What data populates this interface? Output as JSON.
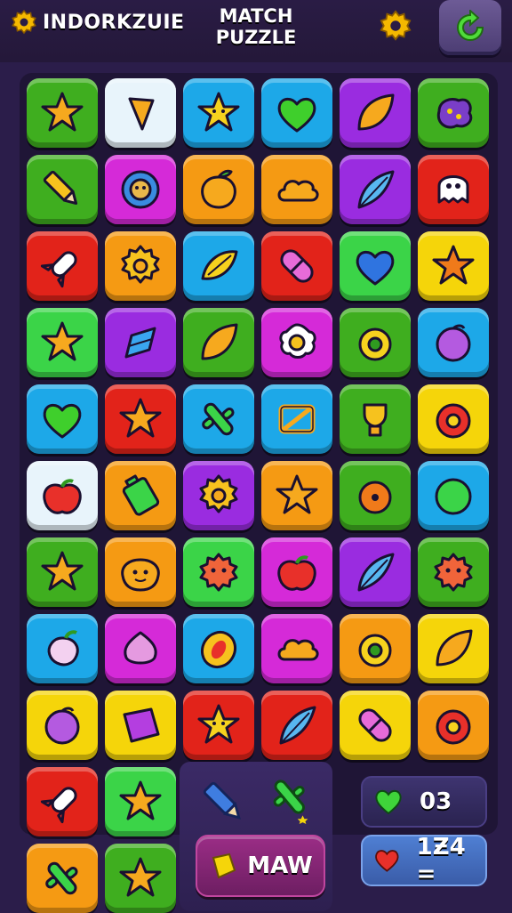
{
  "header": {
    "brand": "INDORKZUIE",
    "title_line1": "MATCH",
    "title_line2": "PUZZLE"
  },
  "colors": {
    "background": "#2b1d4a",
    "board": "#1f1536",
    "green": "#3fae1f",
    "white": "#e8f4fb",
    "cyan": "#1da8e8",
    "purple": "#9a2ce0",
    "orange": "#f59a13",
    "red": "#e2231a",
    "yellow": "#f5d50a",
    "magenta": "#d52ad8",
    "lime": "#3bd448"
  },
  "board": {
    "rows": [
      [
        {
          "color": "green",
          "icon": "star-icon"
        },
        {
          "color": "white",
          "icon": "wing-icon"
        },
        {
          "color": "cyan",
          "icon": "smiley-star-icon"
        },
        {
          "color": "cyan",
          "icon": "heart-icon"
        },
        {
          "color": "purple",
          "icon": "leaf-icon"
        },
        {
          "color": "green",
          "icon": "blob-icon"
        }
      ],
      [
        {
          "color": "green",
          "icon": "pencil-icon"
        },
        {
          "color": "magenta",
          "icon": "flower-face-icon"
        },
        {
          "color": "orange",
          "icon": "fruit-icon"
        },
        {
          "color": "orange",
          "icon": "cloud-icon"
        },
        {
          "color": "purple",
          "icon": "feather-icon"
        },
        {
          "color": "red",
          "icon": "ghost-icon"
        }
      ],
      [
        {
          "color": "red",
          "icon": "rocket-icon"
        },
        {
          "color": "orange",
          "icon": "gear-icon"
        },
        {
          "color": "cyan",
          "icon": "candy-icon"
        },
        {
          "color": "red",
          "icon": "capsule-icon"
        },
        {
          "color": "lime",
          "icon": "blue-heart-icon"
        },
        {
          "color": "yellow",
          "icon": "starfish-icon"
        }
      ],
      [
        {
          "color": "lime",
          "icon": "star-icon"
        },
        {
          "color": "purple",
          "icon": "crystal-icon"
        },
        {
          "color": "green",
          "icon": "leaf-icon"
        },
        {
          "color": "magenta",
          "icon": "egg-icon"
        },
        {
          "color": "green",
          "icon": "ring-icon"
        },
        {
          "color": "cyan",
          "icon": "berry-icon"
        }
      ],
      [
        {
          "color": "cyan",
          "icon": "heart-icon"
        },
        {
          "color": "red",
          "icon": "star-icon"
        },
        {
          "color": "cyan",
          "icon": "cactus-icon"
        },
        {
          "color": "cyan",
          "icon": "bow-icon"
        },
        {
          "color": "green",
          "icon": "trophy-icon"
        },
        {
          "color": "yellow",
          "icon": "donut-icon"
        }
      ],
      [
        {
          "color": "white",
          "icon": "apple-icon"
        },
        {
          "color": "orange",
          "icon": "battery-icon"
        },
        {
          "color": "purple",
          "icon": "gear-icon"
        },
        {
          "color": "orange",
          "icon": "star-icon"
        },
        {
          "color": "green",
          "icon": "orange-fruit-icon"
        },
        {
          "color": "cyan",
          "icon": "ball-icon"
        }
      ],
      [
        {
          "color": "green",
          "icon": "star-icon"
        },
        {
          "color": "orange",
          "icon": "pumpkin-icon"
        },
        {
          "color": "lime",
          "icon": "monster-icon"
        },
        {
          "color": "magenta",
          "icon": "apple-icon"
        },
        {
          "color": "purple",
          "icon": "feather-icon"
        },
        {
          "color": "green",
          "icon": "monster-icon"
        }
      ],
      [
        {
          "color": "cyan",
          "icon": "radish-icon"
        },
        {
          "color": "magenta",
          "icon": "onion-icon"
        },
        {
          "color": "cyan",
          "icon": "seed-icon"
        },
        {
          "color": "magenta",
          "icon": "cloud-icon"
        },
        {
          "color": "orange",
          "icon": "ring-icon"
        },
        {
          "color": "yellow",
          "icon": "leaf-icon"
        }
      ],
      [
        {
          "color": "yellow",
          "icon": "berry-icon"
        },
        {
          "color": "yellow",
          "icon": "gem-icon"
        },
        {
          "color": "red",
          "icon": "smiley-star-icon"
        },
        {
          "color": "red",
          "icon": "feather-icon"
        },
        {
          "color": "yellow",
          "icon": "capsule-icon"
        },
        {
          "color": "orange",
          "icon": "donut-icon"
        }
      ],
      [
        {
          "color": "red",
          "icon": "rocket-icon"
        },
        {
          "color": "lime",
          "icon": "star-icon"
        },
        null,
        null,
        null,
        null
      ],
      [
        {
          "color": "orange",
          "icon": "cactus-icon"
        },
        {
          "color": "green",
          "icon": "star-icon"
        },
        null,
        null,
        null,
        null
      ]
    ]
  },
  "tray": {
    "icons": [
      "pencil-icon",
      "cactus-icon"
    ]
  },
  "action_button": {
    "label": "MAW",
    "icon": "gem-icon"
  },
  "stats": {
    "moves_value": "03",
    "moves_icon": "heart-icon",
    "score_value": "1Ƶ4 =",
    "score_icon": "heart-icon"
  }
}
